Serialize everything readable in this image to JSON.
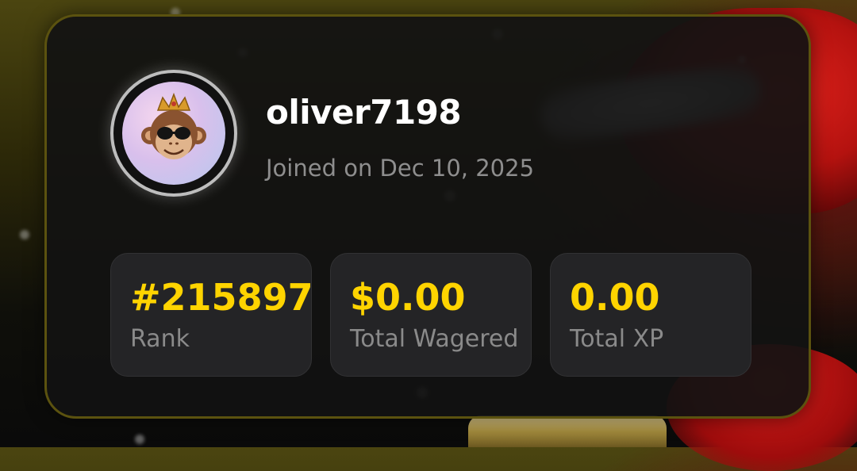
{
  "profile": {
    "username": "oliver7198",
    "joined": "Joined on Dec 10, 2025",
    "avatar_icon": "crowned-monkey-avatar"
  },
  "stats": [
    {
      "value": "#215897",
      "label": "Rank"
    },
    {
      "value": "$0.00",
      "label": "Total Wagered"
    },
    {
      "value": "0.00",
      "label": "Total XP"
    }
  ],
  "colors": {
    "accent": "#ffd400",
    "card_border": "#5b520f",
    "card_bg": "#121212",
    "stat_bg": "#242426",
    "muted_text": "#8e8e8e"
  }
}
